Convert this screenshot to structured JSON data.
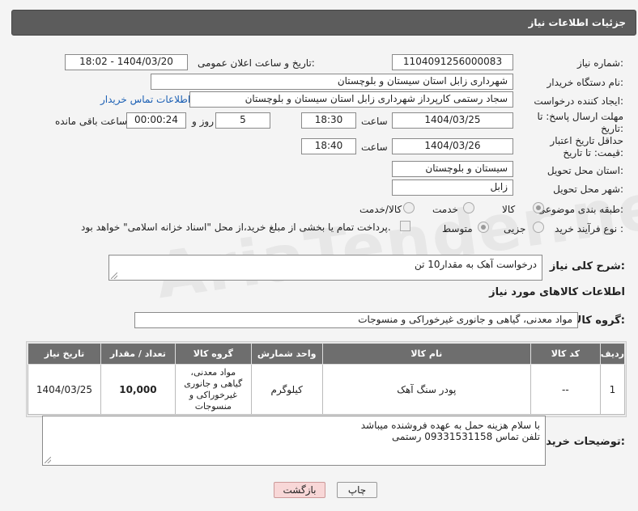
{
  "header": {
    "title": "جزئیات اطلاعات نیاز"
  },
  "watermark": "AriaTender.neT",
  "fields": {
    "need_number_label": "شماره نیاز:",
    "need_number": "1104091256000083",
    "announce_label": "تاریخ و ساعت اعلان عمومی:",
    "announce_value": "1404/03/20 - 18:02",
    "buyer_org_label": "نام دستگاه خریدار:",
    "buyer_org": "شهرداری زابل استان سیستان و بلوچستان",
    "creator_label": "ایجاد کننده درخواست:",
    "creator": "سجاد رستمی کارپرداز شهرداری زابل استان سیستان و بلوچستان",
    "contact_link": "اطلاعات تماس خریدار",
    "deadline_label": "مهلت ارسال پاسخ: تا تاریخ:",
    "deadline_date": "1404/03/25",
    "time_label": "ساعت",
    "deadline_time": "18:30",
    "days_value": "5",
    "days_label": "روز و",
    "remaining_value": "00:00:24",
    "remaining_label": "ساعت باقی مانده",
    "validity_label": "حداقل تاریخ اعتبار قیمت: تا تاریخ:",
    "validity_date": "1404/03/26",
    "validity_time": "18:40",
    "province_label": "استان محل تحویل:",
    "province": "سیستان و بلوچستان",
    "city_label": "شهر محل تحویل:",
    "city": "زابل",
    "category_label": "طبقه بندی موضوعی:",
    "category_options": [
      "کالا",
      "خدمت",
      "کالا/خدمت"
    ],
    "process_label": "نوع فرآیند خرید :",
    "process_options": [
      "جزیی",
      "متوسط"
    ],
    "payment_note": "پرداخت تمام یا بخشی از مبلغ خرید،از محل \"اسناد خزانه اسلامی\" خواهد بود."
  },
  "description": {
    "label": "شرح کلی نیاز:",
    "value": "درخواست آهک  به مقدار10 تن"
  },
  "goods_info_title": "اطلاعات کالاهای مورد نیاز",
  "goods_group": {
    "label": "گروه کالا:",
    "value": "مواد معدنی، گیاهی و جانوری غیرخوراکی و منسوجات"
  },
  "table": {
    "headers": [
      "ردیف",
      "کد کالا",
      "نام کالا",
      "واحد شمارش",
      "گروه کالا",
      "تعداد / مقدار",
      "تاریخ نیاز"
    ],
    "rows": [
      [
        "1",
        "--",
        "پودر سنگ آهک",
        "کیلوگرم",
        "مواد معدنی، گیاهی و جانوری غیرخوراکی و منسوجات",
        "10,000",
        "1404/03/25"
      ]
    ]
  },
  "buyer_notes": {
    "label": "توضیحات خریدار:",
    "line1": "با سلام هزینه حمل به عهده فروشنده میباشد",
    "line2": "تلفن تماس 09331531158 رستمی"
  },
  "buttons": {
    "print": "چاپ",
    "back": "بازگشت"
  },
  "colors": {
    "header_bg": "#5c5c5c",
    "table_header_bg": "#6e6e6e",
    "link": "#1a5fb4",
    "back_btn": "#f8d7d7"
  }
}
